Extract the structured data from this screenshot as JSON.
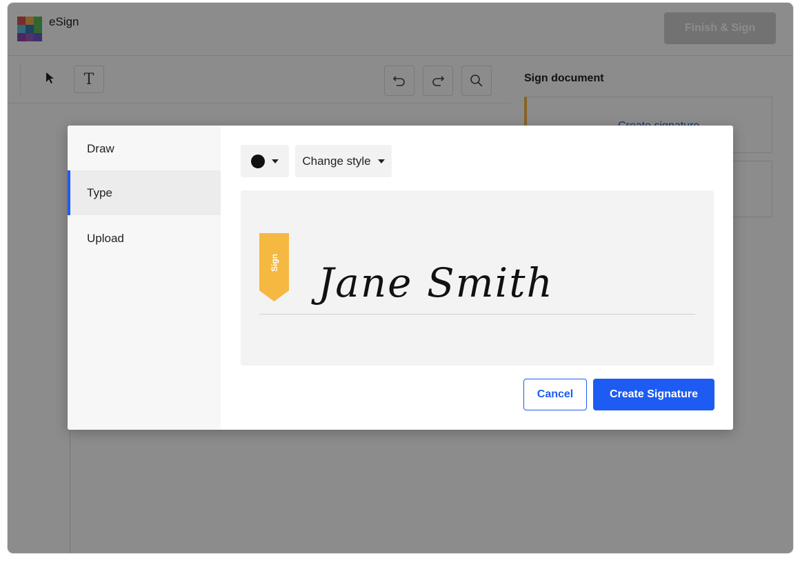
{
  "header": {
    "app_name": "eSign",
    "finish_label": "Finish & Sign"
  },
  "toolbar": {
    "select_icon": "cursor-arrow-icon",
    "text_icon": "text-tool-icon",
    "text_glyph": "T",
    "undo_icon": "undo-icon",
    "redo_icon": "redo-icon",
    "search_icon": "search-icon"
  },
  "panel": {
    "title": "Sign document",
    "create_signature_link": "Create signature"
  },
  "modal": {
    "tabs": [
      {
        "label": "Draw",
        "active": false
      },
      {
        "label": "Type",
        "active": true
      },
      {
        "label": "Upload",
        "active": false
      }
    ],
    "color_value": "#111111",
    "change_style_label": "Change style",
    "sign_flag_label": "Sign",
    "signature_text": "Jane Smith",
    "cancel_label": "Cancel",
    "create_label": "Create Signature"
  },
  "colors": {
    "accent": "#1d5bf2",
    "flag": "#f5b841",
    "overlay": "rgba(0,0,0,0.45)"
  }
}
